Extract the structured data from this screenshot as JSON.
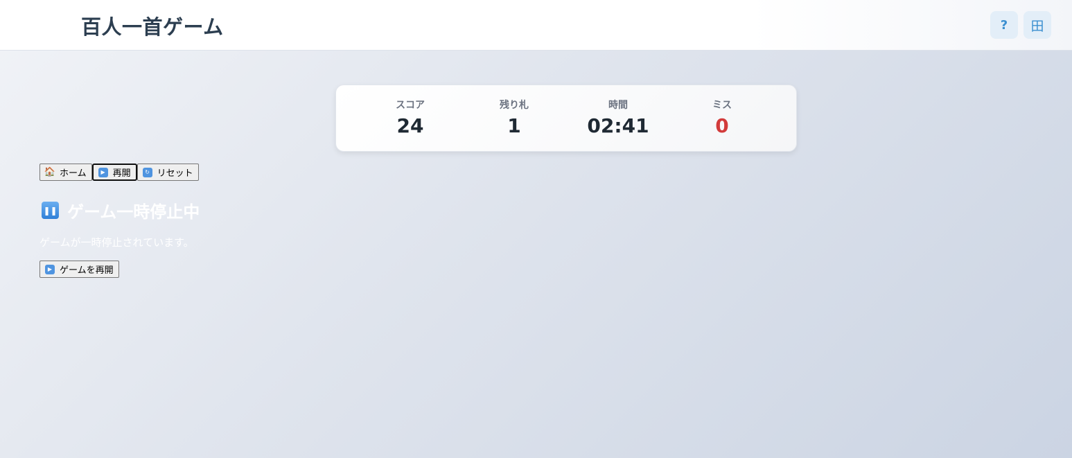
{
  "header": {
    "title": "百人一首ゲーム",
    "help_label": "?",
    "grid_label": "田"
  },
  "stats": {
    "score": {
      "label": "スコア",
      "value": "24"
    },
    "remaining": {
      "label": "残り札",
      "value": "1"
    },
    "time": {
      "label": "時間",
      "value": "02:41"
    },
    "miss": {
      "label": "ミス",
      "value": "0",
      "color": "#d23b3b"
    }
  },
  "controls": {
    "home": {
      "icon": "house-icon",
      "label": "ホーム"
    },
    "resume": {
      "icon": "play-icon",
      "label": "再開"
    },
    "reset": {
      "icon": "refresh-icon",
      "label": "リセット"
    }
  },
  "pause": {
    "icon": "pause-icon",
    "title": "ゲーム一時停止中",
    "message": "ゲームが一時停止されています。",
    "resume_button": {
      "icon": "play-icon",
      "label": "ゲームを再開"
    }
  }
}
